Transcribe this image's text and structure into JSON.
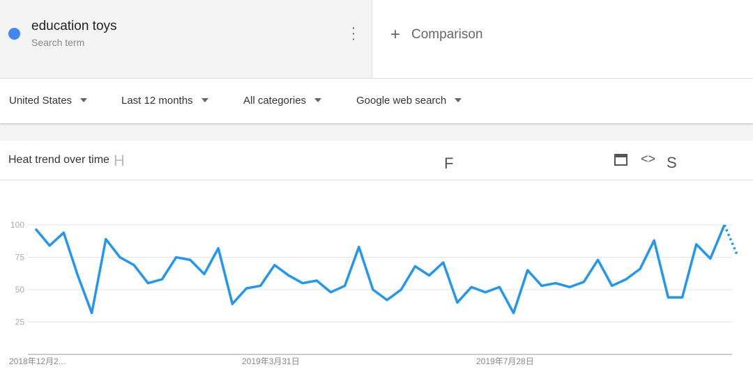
{
  "search_term": {
    "name": "education toys",
    "subtitle": "Search term",
    "color": "#4285f4",
    "more_icon": "more-vert-icon"
  },
  "comparison": {
    "label": "Comparison",
    "icon": "plus-icon"
  },
  "filters": [
    {
      "label": "United States"
    },
    {
      "label": "Last 12 months"
    },
    {
      "label": "All categories"
    },
    {
      "label": "Google web search"
    }
  ],
  "card": {
    "title": "Heat trend over time",
    "glyph_h": "H",
    "glyph_f": "F",
    "glyph_s": "S",
    "icons": [
      "download-icon",
      "embed-icon",
      "share-icon"
    ]
  },
  "chart_data": {
    "type": "line",
    "color": "#2196f3",
    "ylim": [
      0,
      100
    ],
    "yticks": [
      25,
      50,
      75,
      100
    ],
    "xtick_labels": [
      "2018年12月2...",
      "2019年3月31日",
      "2019年7月28日"
    ],
    "grid": true,
    "values": [
      97,
      84,
      94,
      61,
      32,
      89,
      75,
      69,
      55,
      58,
      75,
      73,
      62,
      82,
      39,
      51,
      53,
      69,
      61,
      55,
      57,
      48,
      53,
      83,
      50,
      42,
      50,
      68,
      61,
      71,
      40,
      52,
      48,
      52,
      32,
      65,
      53,
      55,
      52,
      56,
      73,
      53,
      58,
      66,
      88,
      44,
      44,
      85,
      74,
      100,
      76
    ],
    "partial_last_point": true
  }
}
